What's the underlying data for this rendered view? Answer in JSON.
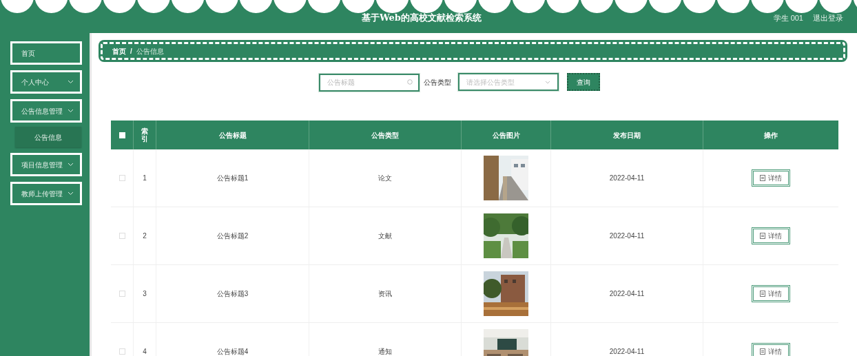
{
  "header": {
    "title": "基于Web的高校文献检索系统",
    "user": "学生 001",
    "logout": "退出登录"
  },
  "sidebar": {
    "items": [
      {
        "label": "首页",
        "has_children": false
      },
      {
        "label": "个人中心",
        "has_children": true
      },
      {
        "label": "公告信息管理",
        "has_children": true,
        "children": [
          {
            "label": "公告信息",
            "selected": true
          }
        ]
      },
      {
        "label": "项目信息管理",
        "has_children": true
      },
      {
        "label": "教师上传管理",
        "has_children": true
      }
    ]
  },
  "breadcrumb": [
    "首页",
    "公告信息"
  ],
  "breadcrumb_separator": "/",
  "search": {
    "title_placeholder": "公告标题",
    "type_label": "公告类型",
    "type_placeholder": "请选择公告类型",
    "button": "查询"
  },
  "table": {
    "columns": [
      "索引",
      "公告标题",
      "公告类型",
      "公告图片",
      "发布日期",
      "操作"
    ],
    "header_checked": false,
    "rows": [
      {
        "checked": false,
        "index": "1",
        "title": "公告标题1",
        "type": "论文",
        "date": "2022-04-11",
        "action": "详情"
      },
      {
        "checked": false,
        "index": "2",
        "title": "公告标题2",
        "type": "文献",
        "date": "2022-04-11",
        "action": "详情"
      },
      {
        "checked": false,
        "index": "3",
        "title": "公告标题3",
        "type": "资讯",
        "date": "2022-04-11",
        "action": "详情"
      },
      {
        "checked": false,
        "index": "4",
        "title": "公告标题4",
        "type": "通知",
        "date": "2022-04-11",
        "action": "详情"
      }
    ]
  }
}
